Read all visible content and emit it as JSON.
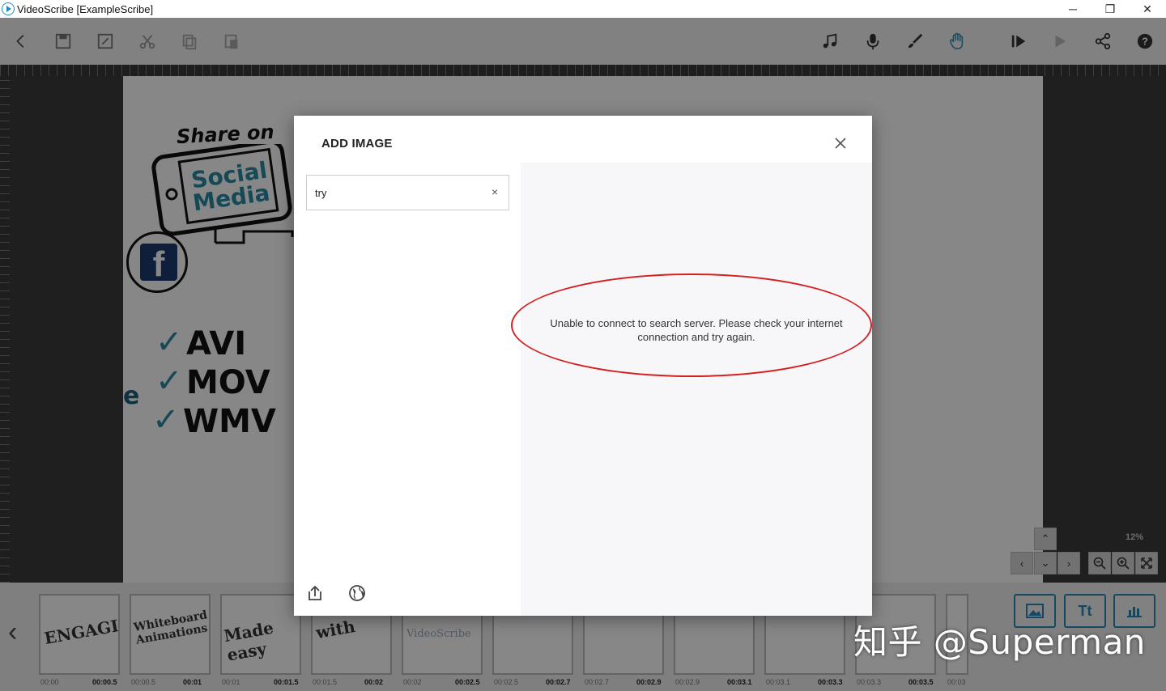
{
  "window": {
    "title": "VideoScribe [ExampleScribe]",
    "min": "─",
    "max": "❐",
    "close": "✕"
  },
  "toolbar": {
    "left_icons": [
      "back-icon",
      "save-icon",
      "save-as-icon",
      "cut-icon",
      "copy-icon",
      "paste-icon"
    ],
    "right_icons": [
      "music-icon",
      "microphone-icon",
      "brush-icon",
      "hand-icon",
      "play-from-icon",
      "play-icon",
      "share-icon",
      "help-icon"
    ]
  },
  "canvas": {
    "share_text": "Share on",
    "social_text": "Social",
    "media_text": "Media",
    "fb_letter": "f",
    "formats": [
      "AVI",
      "MOV",
      "WMV"
    ],
    "partial_letter": "e"
  },
  "dialog": {
    "title": "ADD IMAGE",
    "search_value": "try",
    "clear_label": "×",
    "error_message": "Unable to connect to search server. Please check your internet connection and try again."
  },
  "zoom": {
    "level": "12%"
  },
  "timeline": {
    "thumbs": [
      {
        "text": "ENGAGING",
        "start": "00:00",
        "end": "00:00.5"
      },
      {
        "text": "Whiteboard Animations",
        "start": "00:00.5",
        "end": "00:01"
      },
      {
        "text": "Made easy",
        "start": "00:01",
        "end": "00:01.5"
      },
      {
        "text": "with",
        "start": "00:01.5",
        "end": "00:02"
      },
      {
        "text": "VideoScribe",
        "start": "00:02",
        "end": "00:02.5"
      },
      {
        "text": "",
        "start": "00:02.5",
        "end": "00:02.7"
      },
      {
        "text": "",
        "start": "00:02.7",
        "end": "00:02.9"
      },
      {
        "text": "",
        "start": "00:02.9",
        "end": "00:03.1"
      },
      {
        "text": "",
        "start": "00:03.1",
        "end": "00:03.3"
      },
      {
        "text": "",
        "start": "00:03.3",
        "end": "00:03.5"
      },
      {
        "text": "",
        "start": "00:03",
        "end": ""
      }
    ],
    "add_buttons": [
      {
        "label": "",
        "icon": "add-image-icon"
      },
      {
        "label": "Tt",
        "icon": "add-text-icon"
      },
      {
        "label": "",
        "icon": "add-chart-icon"
      }
    ]
  },
  "watermark": "知乎 @Superman",
  "colors": {
    "accent": "#2a88b8",
    "highlight": "#d42020"
  }
}
